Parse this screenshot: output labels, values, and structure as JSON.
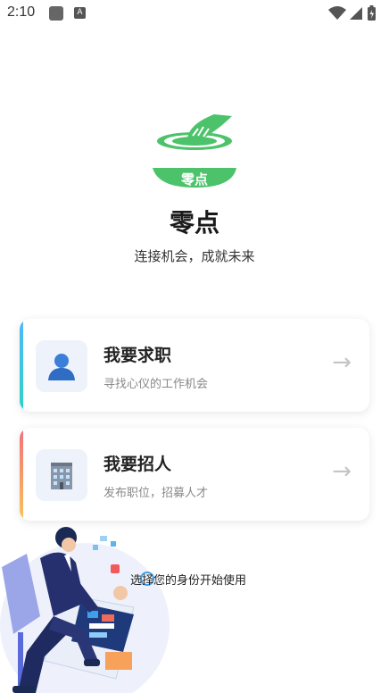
{
  "status_bar": {
    "time": "2:10",
    "notification_icon_letter": "A"
  },
  "app": {
    "name": "零点",
    "logo_text": "零点",
    "tagline": "连接机会，成就未来",
    "brand_color": "#4cc36a"
  },
  "cards": [
    {
      "title": "我要求职",
      "description": "寻找心仪的工作机会",
      "icon": "person-icon",
      "accent_top": "#4fb7f7",
      "accent_bottom": "#2ed3c8",
      "arrow": "→"
    },
    {
      "title": "我要招人",
      "description": "发布职位，招募人才",
      "icon": "office-building-icon",
      "accent_top": "#f3707a",
      "accent_bottom": "#f7c35a",
      "arrow": "→"
    }
  ],
  "footer_hint": "选择您的身份开始使用"
}
